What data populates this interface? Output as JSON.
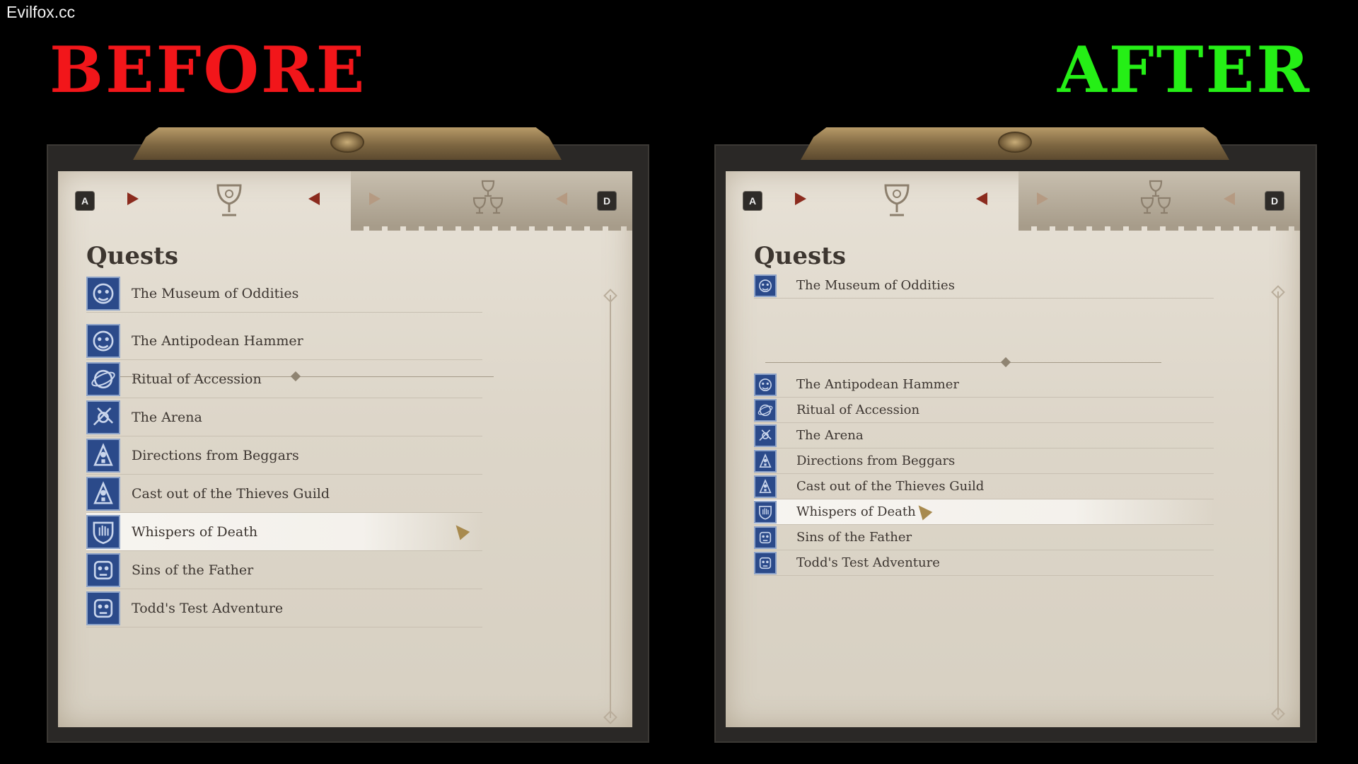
{
  "watermark": "Evilfox.cc",
  "labels": {
    "before": "BEFORE",
    "after": "AFTER"
  },
  "colors": {
    "before": "#f2161a",
    "after": "#25ef16",
    "quest_icon_bg": "#2b4a8a",
    "paper": "#e2dccf"
  },
  "panels": [
    {
      "id": "before",
      "key_left": "A",
      "key_right": "D",
      "heading": "Quests",
      "pinned": {
        "title": "The Museum of Oddities",
        "icon": "mask-icon"
      },
      "quests": [
        {
          "title": "The Antipodean Hammer",
          "icon": "mask-icon"
        },
        {
          "title": "Ritual of Accession",
          "icon": "orb-icon"
        },
        {
          "title": "The Arena",
          "icon": "arena-icon"
        },
        {
          "title": "Directions from Beggars",
          "icon": "hooded-figure-icon"
        },
        {
          "title": "Cast out of the Thieves Guild",
          "icon": "hooded-figure-icon"
        },
        {
          "title": "Whispers of Death",
          "icon": "hand-shield-icon",
          "selected": true
        },
        {
          "title": "Sins of the Father",
          "icon": "face-icon"
        },
        {
          "title": "Todd's Test Adventure",
          "icon": "face-icon"
        }
      ]
    },
    {
      "id": "after",
      "key_left": "A",
      "key_right": "D",
      "heading": "Quests",
      "pinned": {
        "title": "The Museum of Oddities",
        "icon": "mask-icon"
      },
      "quests": [
        {
          "title": "The Antipodean Hammer",
          "icon": "mask-icon"
        },
        {
          "title": "Ritual of Accession",
          "icon": "orb-icon"
        },
        {
          "title": "The Arena",
          "icon": "arena-icon"
        },
        {
          "title": "Directions from Beggars",
          "icon": "hooded-figure-icon"
        },
        {
          "title": "Cast out of the Thieves Guild",
          "icon": "hooded-figure-icon"
        },
        {
          "title": "Whispers of Death",
          "icon": "hand-shield-icon",
          "selected": true
        },
        {
          "title": "Sins of the Father",
          "icon": "face-icon"
        },
        {
          "title": "Todd's Test Adventure",
          "icon": "face-icon"
        }
      ]
    }
  ]
}
